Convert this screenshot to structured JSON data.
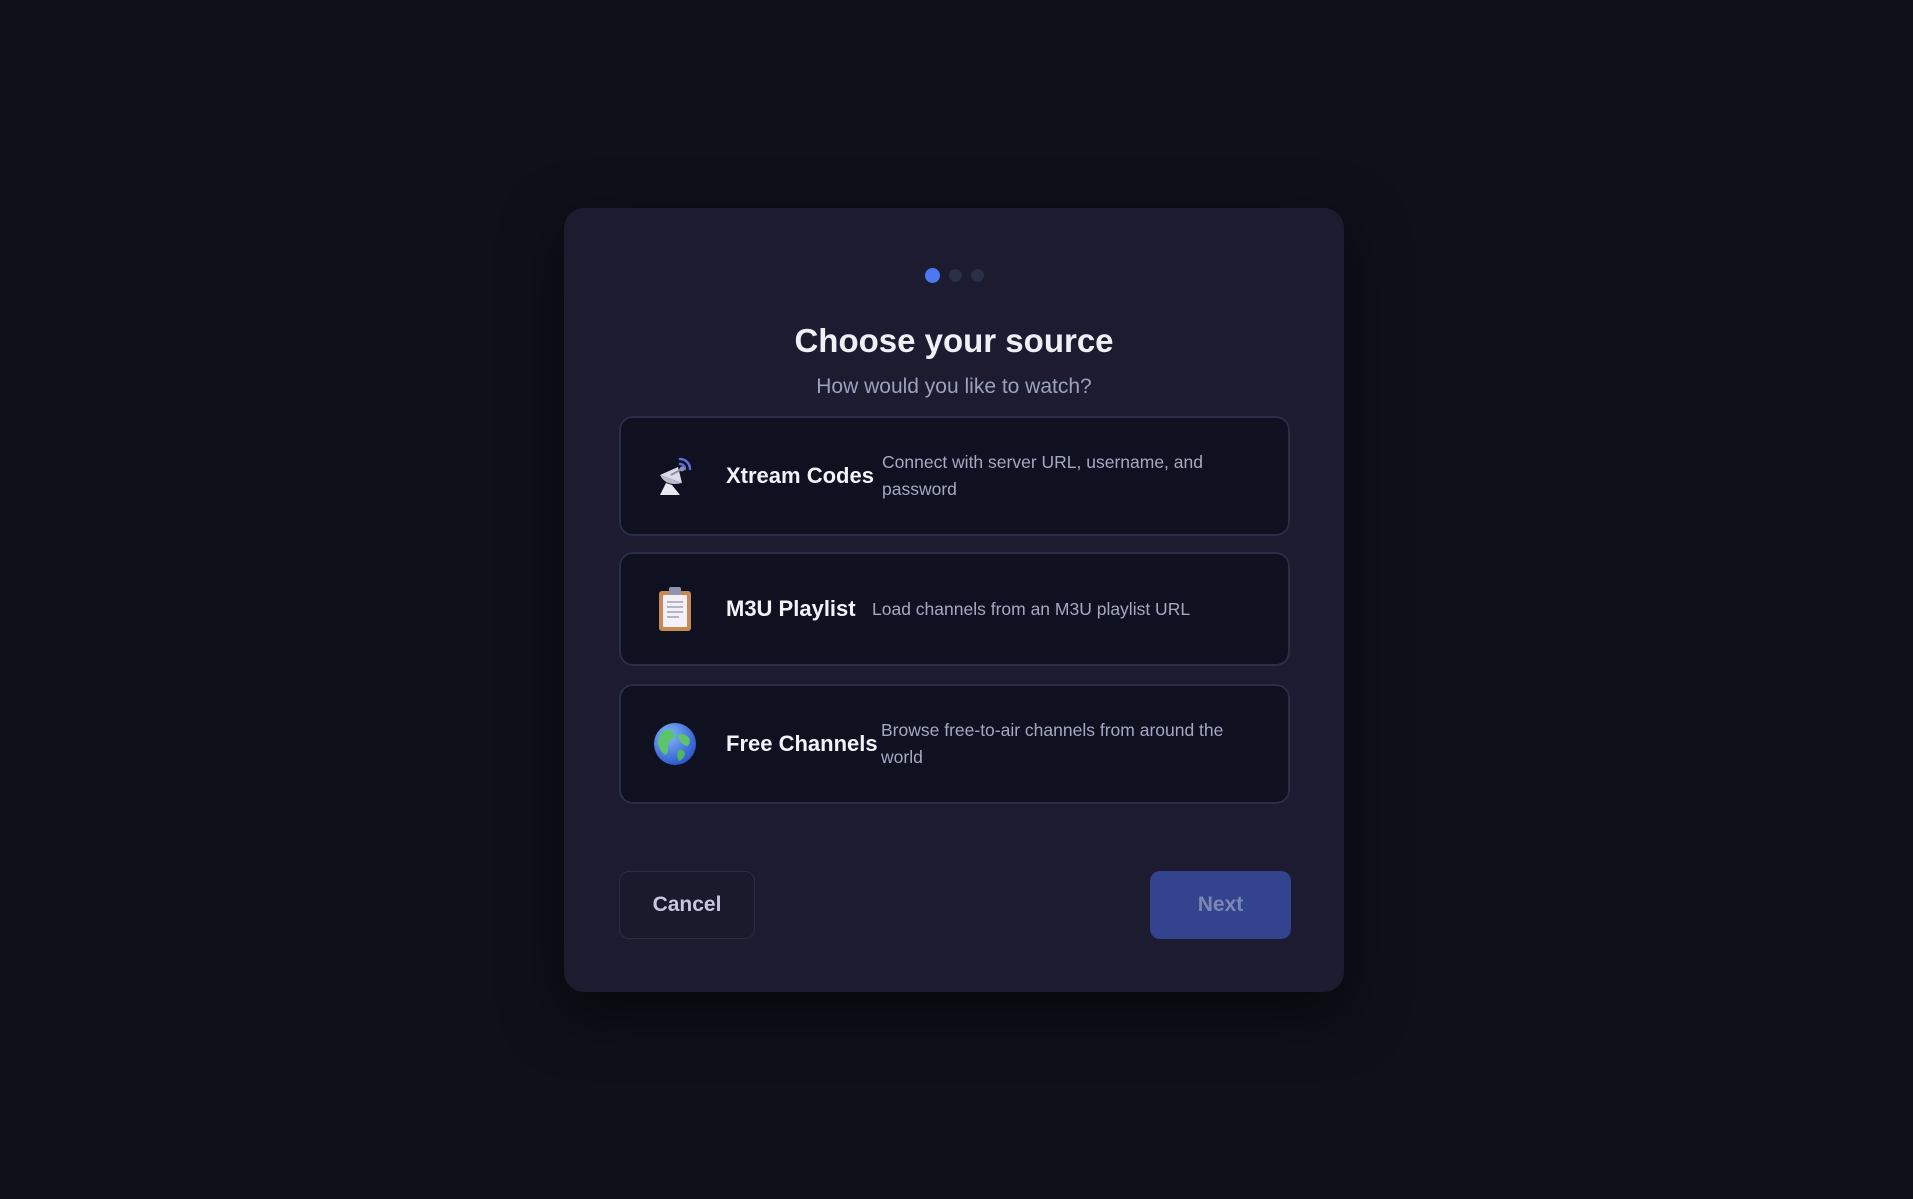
{
  "wizard": {
    "steps": {
      "total": 3,
      "current": 1
    },
    "title": "Choose your source",
    "subtitle": "How would you like to watch?",
    "options": [
      {
        "icon": "satellite-dish-icon",
        "name": "Xtream Codes",
        "description": "Connect with server URL, username, and password"
      },
      {
        "icon": "clipboard-icon",
        "name": "M3U Playlist",
        "description": "Load channels from an M3U playlist URL"
      },
      {
        "icon": "globe-icon",
        "name": "Free Channels",
        "description": "Browse free-to-air channels from around the world"
      }
    ],
    "cancel_label": "Cancel",
    "next_label": "Next"
  },
  "colors": {
    "background": "#0f1019",
    "dialog": "#1c1b2f",
    "accent": "#4d79f0",
    "next_button": "#34438e"
  }
}
